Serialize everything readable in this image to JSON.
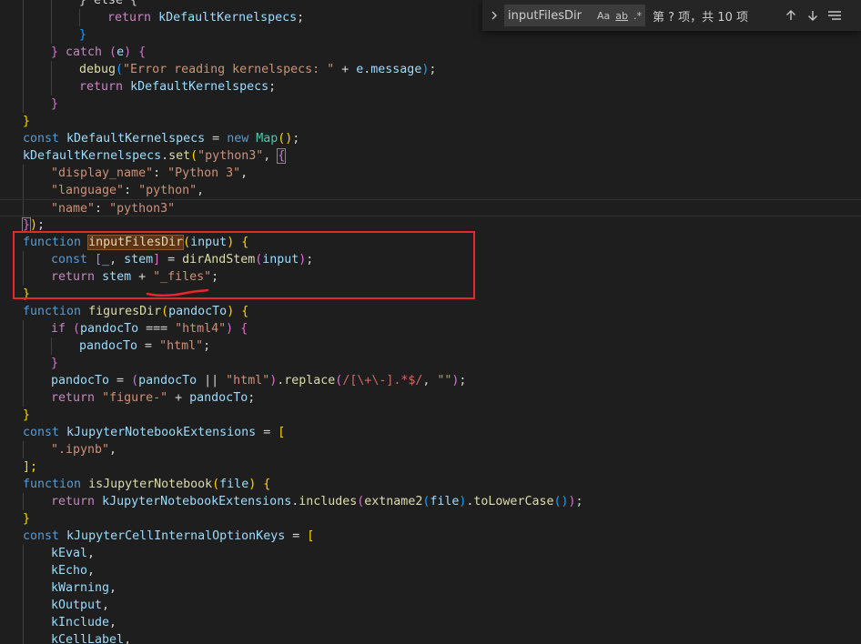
{
  "find": {
    "query": "inputFilesDir",
    "match_case_label": "Aa",
    "whole_word_label": "ab",
    "regex_label": ".*",
    "match_count": "第 ? 项，共 10 项",
    "expand_icon": "chevron-right-icon",
    "prev_icon": "arrow-up-icon",
    "next_icon": "arrow-down-icon",
    "selection_icon": "find-in-selection-icon"
  },
  "highlight": {
    "match_color": "#613214",
    "annotation_color": "#e8262c"
  },
  "code": {
    "l1_kw": "} else {",
    "l2_ret": "return",
    "l2_val": "kDefaultKernelspecs",
    "l3": "}",
    "l4_a": "} ",
    "l4_catch": "catch",
    "l4_b": " (",
    "l4_e": "e",
    "l4_c": ") {",
    "l5_fn": "debug",
    "l5_str": "\"Error reading kernelspecs: \"",
    "l5_plus": " + ",
    "l5_e": "e",
    "l5_msg": "message",
    "l6_ret": "return",
    "l6_val": "kDefaultKernelspecs",
    "l7": "}",
    "l8": "}",
    "l9_const": "const",
    "l9_name": "kDefaultKernelspecs",
    "l9_new": "new",
    "l9_map": "Map",
    "l10_var": "kDefaultKernelspecs",
    "l10_set": "set",
    "l10_str": "\"python3\"",
    "l11_key": "\"display_name\"",
    "l11_val": "\"Python 3\"",
    "l12_key": "\"language\"",
    "l12_val": "\"python\"",
    "l13_key": "\"name\"",
    "l13_val": "\"python3\"",
    "l15_fn_kw": "function",
    "l15_name": "inputFilesDir",
    "l15_param": "input",
    "l16_const": "const",
    "l16_us": "_",
    "l16_stem": "stem",
    "l16_fn": "dirAndStem",
    "l16_arg": "input",
    "l17_ret": "return",
    "l17_stem": "stem",
    "l17_str": "\"_files\"",
    "l18": "}",
    "l19_fn_kw": "function",
    "l19_name": "figuresDir",
    "l19_param": "pandocTo",
    "l20_if": "if",
    "l20_var": "pandocTo",
    "l20_op": " === ",
    "l20_str": "\"html4\"",
    "l21_var": "pandocTo",
    "l21_str": "\"html\"",
    "l22": "}",
    "l23_var": "pandocTo",
    "l23_var2": "pandocTo",
    "l23_str": "\"html\"",
    "l23_fn": "replace",
    "l23_regex": "/[\\+\\-].*$/",
    "l23_str2": "\"\"",
    "l24_ret": "return",
    "l24_str": "\"figure-\"",
    "l24_var": "pandocTo",
    "l25": "}",
    "l26_const": "const",
    "l26_name": "kJupyterNotebookExtensions",
    "l27_str": "\".ipynb\"",
    "l28": "];",
    "l29_fn_kw": "function",
    "l29_name": "isJupyterNotebook",
    "l29_param": "file",
    "l30_ret": "return",
    "l30_var": "kJupyterNotebookExtensions",
    "l30_fn": "includes",
    "l30_fn2": "extname2",
    "l30_arg": "file",
    "l30_fn3": "toLowerCase",
    "l31": "}",
    "l32_const": "const",
    "l32_name": "kJupyterCellInternalOptionKeys",
    "l33": "kEval",
    "l34": "kEcho",
    "l35": "kWarning",
    "l36": "kOutput",
    "l37": "kInclude",
    "l38": "kCellLabel"
  }
}
